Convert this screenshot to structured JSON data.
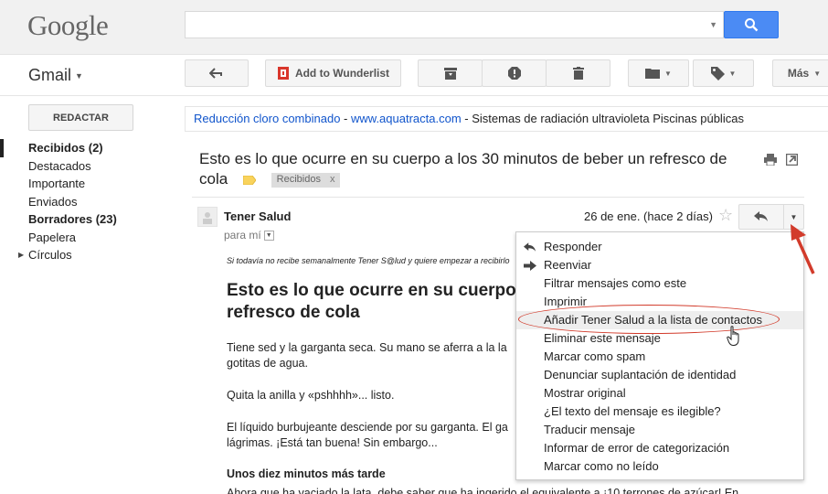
{
  "brand": {
    "logo": "Google",
    "app": "Gmail"
  },
  "search": {
    "placeholder": ""
  },
  "toolbar": {
    "wunderlist_label": "Add to Wunderlist",
    "more_label": "Más"
  },
  "sidebar": {
    "compose_label": "REDACTAR",
    "items": [
      {
        "label": "Recibidos (2)",
        "bold": true,
        "active": true
      },
      {
        "label": "Destacados"
      },
      {
        "label": "Importante"
      },
      {
        "label": "Enviados"
      },
      {
        "label": "Borradores (23)",
        "bold": true
      },
      {
        "label": "Papelera"
      },
      {
        "label": "Círculos",
        "expander": true
      }
    ]
  },
  "ad": {
    "link_text": "Reducción cloro combinado",
    "separator1": " - ",
    "url_text": "www.aquatracta.com",
    "separator2": " - ",
    "description": "Sistemas de radiación ultravioleta Piscinas públicas"
  },
  "message": {
    "subject": "Esto es lo que ocurre en su cuerpo a los 30 minutos de beber un refresco de cola",
    "label_chip": "Recibidos",
    "label_chip_close": "x",
    "sender": "Tener Salud",
    "to_text": "para mí",
    "date": "26 de ene. (hace 2 días)",
    "intro": "Si todavía no recibe semanalmente Tener S@lud y quiere empezar a recibirlo",
    "heading": "Esto es lo que ocurre en su cuerpo\nrefresco de cola",
    "para1": "Tiene sed y la garganta seca. Su mano se aferra a la la\ngotitas de agua.",
    "para2": "Quita la anilla y «pshhhh»... listo.",
    "para3": "El líquido burbujeante desciende por su garganta. El ga\nlágrimas. ¡Está tan buena! Sin embargo...",
    "subheading": "Unos diez minutos más tarde",
    "cutoff": "Ahora que ha vaciado la lata, debe saber que ha ingerido el equivalente a ¡10 terrones de azúcar! En"
  },
  "menu": {
    "items": [
      {
        "label": "Responder",
        "icon": "reply-icon"
      },
      {
        "label": "Reenviar",
        "icon": "forward-icon"
      },
      {
        "label": "Filtrar mensajes como este"
      },
      {
        "label": "Imprimir"
      },
      {
        "label": "Añadir Tener Salud a la lista de contactos",
        "highlighted": true
      },
      {
        "label": "Eliminar este mensaje"
      },
      {
        "label": "Marcar como spam"
      },
      {
        "label": "Denunciar suplantación de identidad"
      },
      {
        "label": "Mostrar original"
      },
      {
        "label": "¿El texto del mensaje es ilegible?"
      },
      {
        "label": "Traducir mensaje"
      },
      {
        "label": "Informar de error de categorización"
      },
      {
        "label": "Marcar como no leído"
      }
    ]
  },
  "colors": {
    "accent_blue": "#4b8bf4",
    "link": "#1155cc",
    "annotation_red": "#d23b2b",
    "label_yellow": "#f9d35c"
  }
}
